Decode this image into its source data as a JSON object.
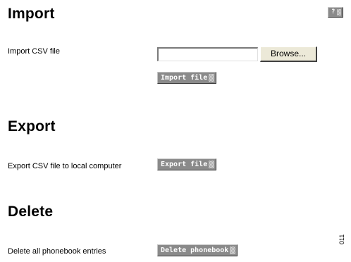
{
  "help": {
    "label": "?"
  },
  "import": {
    "heading": "Import",
    "label": "Import CSV file",
    "file_value": "",
    "browse_label": "Browse...",
    "button_label": "Import file"
  },
  "export": {
    "heading": "Export",
    "label": "Export CSV file to local computer",
    "button_label": "Export file"
  },
  "delete": {
    "heading": "Delete",
    "label": "Delete all phonebook entries",
    "button_label": "Delete phonebook"
  },
  "figure_id": "011",
  "colors": {
    "button_bg": "#8a8a8a",
    "button_text": "#ffffff",
    "page_bg": "#ffffff"
  }
}
